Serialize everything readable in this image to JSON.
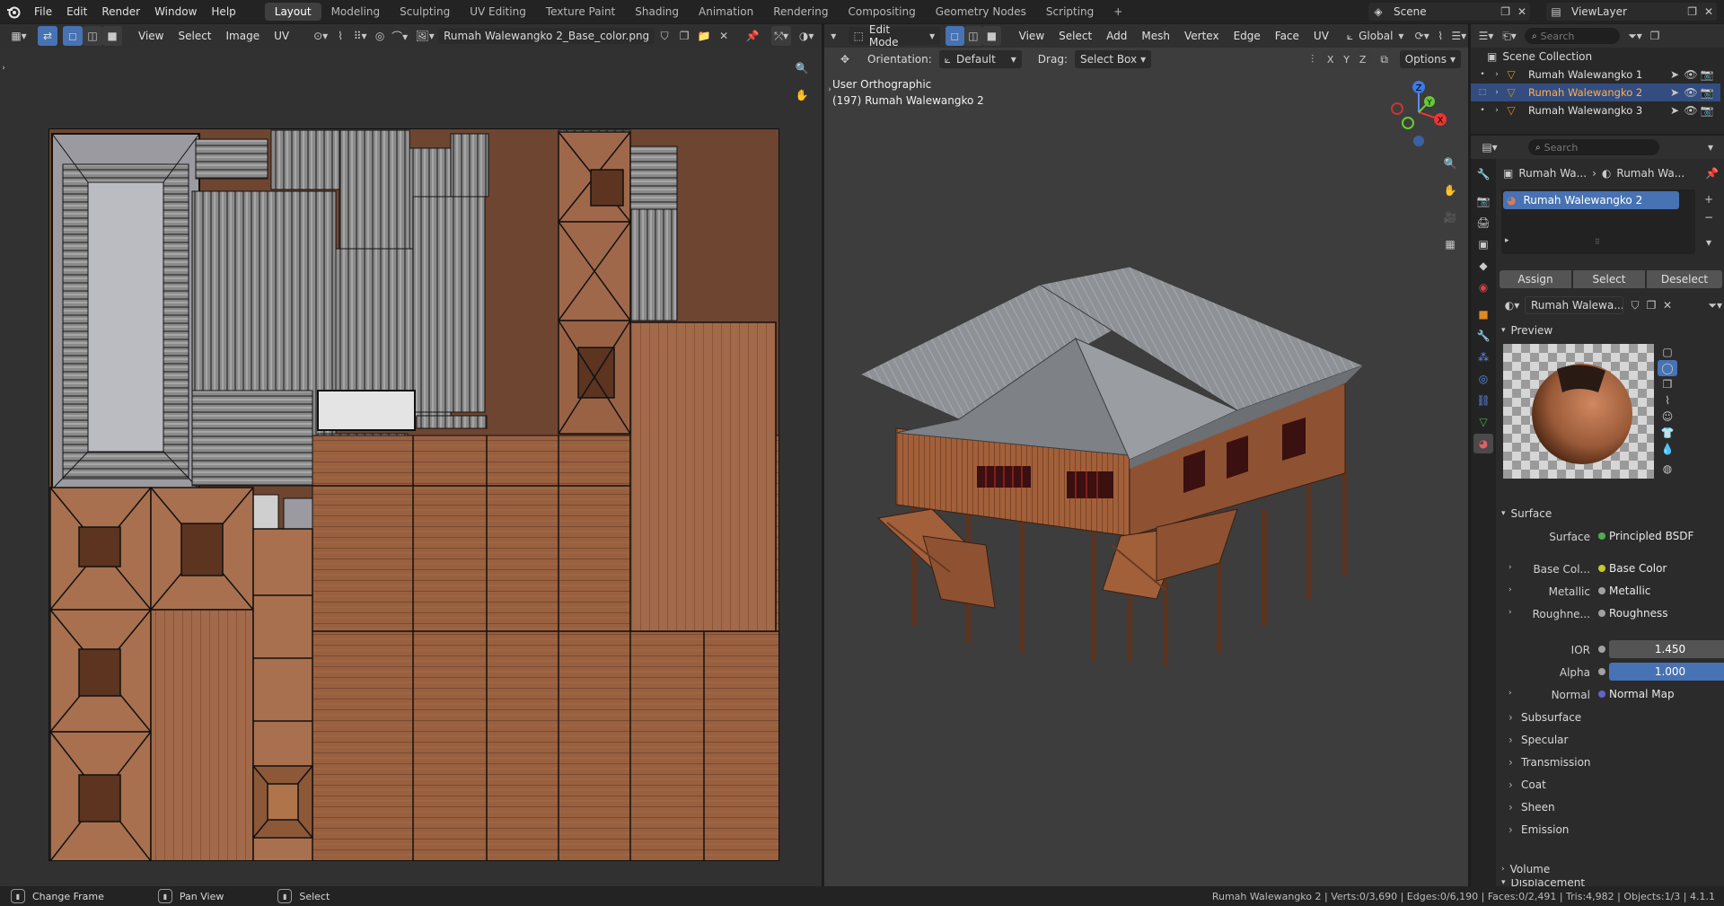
{
  "topbar": {
    "menus": [
      "File",
      "Edit",
      "Render",
      "Window",
      "Help"
    ],
    "workspaces": [
      "Layout",
      "Modeling",
      "Sculpting",
      "UV Editing",
      "Texture Paint",
      "Shading",
      "Animation",
      "Rendering",
      "Compositing",
      "Geometry Nodes",
      "Scripting"
    ],
    "active_workspace": "Layout",
    "add_tab": "+",
    "scene_label": "Scene",
    "viewlayer_label": "ViewLayer"
  },
  "uv_editor": {
    "menus": [
      "View",
      "Select",
      "Image",
      "UV"
    ],
    "image_name": "Rumah Walewangko 2_Base_color.png"
  },
  "viewport": {
    "mode": "Edit Mode",
    "menus": [
      "View",
      "Select",
      "Add",
      "Mesh",
      "Vertex",
      "Edge",
      "Face",
      "UV"
    ],
    "transform_orientation": "Global",
    "orientation_label": "Orientation:",
    "orientation_value": "Default",
    "drag_label": "Drag:",
    "drag_value": "Select Box",
    "options_label": "Options",
    "axis_labels": [
      "X",
      "Y",
      "Z"
    ],
    "view_name": "User Orthographic",
    "object_info": "(197) Rumah Walewangko 2",
    "gizmo": {
      "z": "Z",
      "y": "Y",
      "x": "X"
    }
  },
  "outliner": {
    "search_placeholder": "Search",
    "root": "Scene Collection",
    "items": [
      {
        "name": "Rumah Walewangko 1",
        "active": false
      },
      {
        "name": "Rumah Walewangko 2",
        "active": true
      },
      {
        "name": "Rumah Walewangko 3",
        "active": false
      }
    ]
  },
  "properties": {
    "search_placeholder": "Search",
    "breadcrumb": [
      "Rumah Wa...",
      "Rumah Wa..."
    ],
    "material_slot": "Rumah Walewangko 2",
    "assign": "Assign",
    "select": "Select",
    "deselect": "Deselect",
    "material_name": "Rumah Walewa...",
    "preview_label": "Preview",
    "surface_section": "Surface",
    "surface_label": "Surface",
    "surface_value": "Principled BSDF",
    "inputs": [
      {
        "label": "Base Col...",
        "value": "Base Color",
        "expand": true
      },
      {
        "label": "Metallic",
        "value": "Metallic",
        "expand": true
      },
      {
        "label": "Roughne...",
        "value": "Roughness",
        "expand": true
      }
    ],
    "ior_label": "IOR",
    "ior_value": "1.450",
    "alpha_label": "Alpha",
    "alpha_value": "1.000",
    "normal_label": "Normal",
    "normal_value": "Normal Map",
    "subsections": [
      "Subsurface",
      "Specular",
      "Transmission",
      "Coat",
      "Sheen",
      "Emission"
    ],
    "volume": "Volume",
    "displacement": "Displacement"
  },
  "statusbar": {
    "left": [
      {
        "icon": "mouse-left-icon",
        "label": "Change Frame"
      },
      {
        "icon": "mouse-middle-icon",
        "label": "Pan View"
      },
      {
        "icon": "mouse-right-icon",
        "label": "Select"
      }
    ],
    "stats": "Rumah Walewangko 2 | Verts:0/3,690 | Edges:0/6,190 | Faces:0/2,491 | Tris:4,982 | Objects:1/3 | 4.1.1"
  },
  "colors": {
    "accent": "#4772b3",
    "active_row": "#334d80",
    "wood": "#9a5f3f",
    "roof": "#8d9094"
  }
}
